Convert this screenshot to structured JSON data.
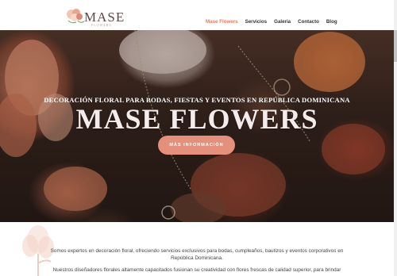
{
  "brand": {
    "logo_text": "MASE",
    "logo_subtext": "FLOWERS",
    "accent_color": "#e57b63",
    "button_color": "#e58f7d"
  },
  "nav": {
    "items": [
      {
        "label": "Mase Flowers",
        "active": true
      },
      {
        "label": "Servicios",
        "active": false
      },
      {
        "label": "Galeria",
        "active": false
      },
      {
        "label": "Contacto",
        "active": false
      },
      {
        "label": "Blog",
        "active": false
      }
    ]
  },
  "hero": {
    "tagline": "DECORACIÓN FLORAL PARA BODAS, FIESTAS Y EVENTOS EN REPÚBLICA DOMINICANA",
    "title": "MASE FLOWERS",
    "button_label": "MÁS INFORMACIÓN"
  },
  "content": {
    "paragraph1": "Somos expertos en decoración floral, ofreciendo servicios exclusivos para bodas, cumpleaños, bautizos y eventos corporativos en República Dominicana.",
    "paragraph2": "Nuestros diseñadores florales altamente capacitados fusionan su creatividad con flores frescas de calidad superior, para brindar"
  }
}
